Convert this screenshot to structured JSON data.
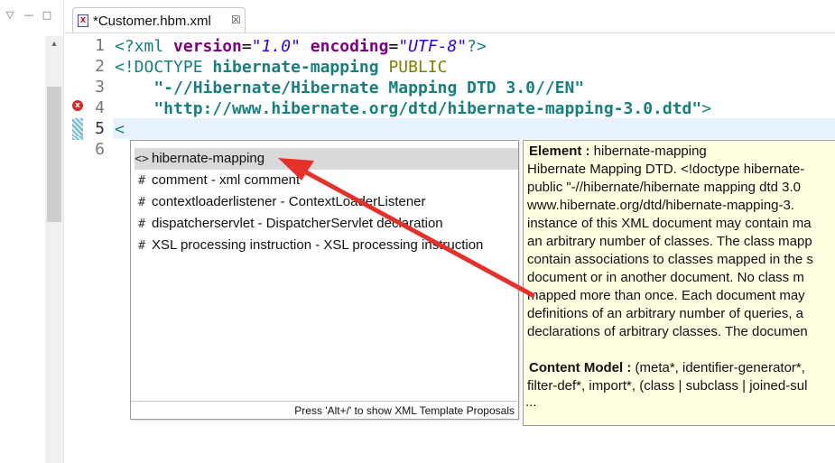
{
  "editor_tab": {
    "title": "*Customer.hbm.xml",
    "close_glyph": "☒"
  },
  "left_panel": {
    "minimize_glyph": "▽",
    "restore_glyph": "□",
    "up_arrow": "▴"
  },
  "gutter": {
    "line_numbers": [
      "1",
      "2",
      "3",
      "4",
      "5",
      "6"
    ],
    "error_marker": "x"
  },
  "code": {
    "line1": {
      "t1": "<?xml ",
      "a1": "version",
      "e1": "=",
      "s1": "\"1.0\"",
      "sp": " ",
      "a2": "encoding",
      "e2": "=",
      "s2": "\"UTF-8\"",
      "t2": "?>"
    },
    "line2": {
      "t1": "<!DOCTYPE ",
      "name": "hibernate-mapping",
      "sp": " ",
      "kw": "PUBLIC"
    },
    "line3": {
      "text": "    \"-//Hibernate/Hibernate Mapping DTD 3.0//EN\""
    },
    "line4": {
      "text": "    \"http://www.hibernate.org/dtd/hibernate-mapping-3.0.dtd\"",
      "close": ">"
    },
    "line5": {
      "text": "<"
    },
    "line6": {
      "text": ""
    }
  },
  "proposals": {
    "items": [
      {
        "icon": "<>",
        "label": "hibernate-mapping",
        "selected": true
      },
      {
        "icon": "#",
        "label": "comment - xml comment"
      },
      {
        "icon": "#",
        "label": "contextloaderlistener - ContextLoaderListener"
      },
      {
        "icon": "#",
        "label": "dispatcherservlet - DispatcherServlet declaration"
      },
      {
        "icon": "#",
        "label": "XSL processing instruction - XSL processing instruction"
      }
    ],
    "footer": "Press 'Alt+/' to show XML Template Proposals"
  },
  "info": {
    "element_label": "Element :",
    "element_value": " hibernate-mapping",
    "description_lines": [
      "Hibernate Mapping DTD. <!doctype hibernate-",
      " public \"-//hibernate/hibernate mapping dtd 3.0",
      " www.hibernate.org/dtd/hibernate-mapping-3.",
      " instance of this XML document may contain ma",
      " an arbitrary number of classes. The class mapp",
      " contain associations to classes mapped in the s",
      " document or in another document. No class m",
      " mapped more than once. Each document may",
      " definitions of an arbitrary number of queries, a",
      " declarations of arbitrary classes. The documen"
    ],
    "content_model_label": "Content Model :",
    "content_model_value": " (meta*, identifier-generator*,",
    "content_model_lines": [
      " filter-def*, import*, (class | subclass | joined-sul",
      " ..."
    ]
  },
  "colors": {
    "annotation_arrow": "#e8302a",
    "info_background": "#ffffe1",
    "selected_proposal": "#d9d9d9",
    "tag_color": "#17807e",
    "attr_color": "#7f007f",
    "string_color": "#2a00ff"
  }
}
